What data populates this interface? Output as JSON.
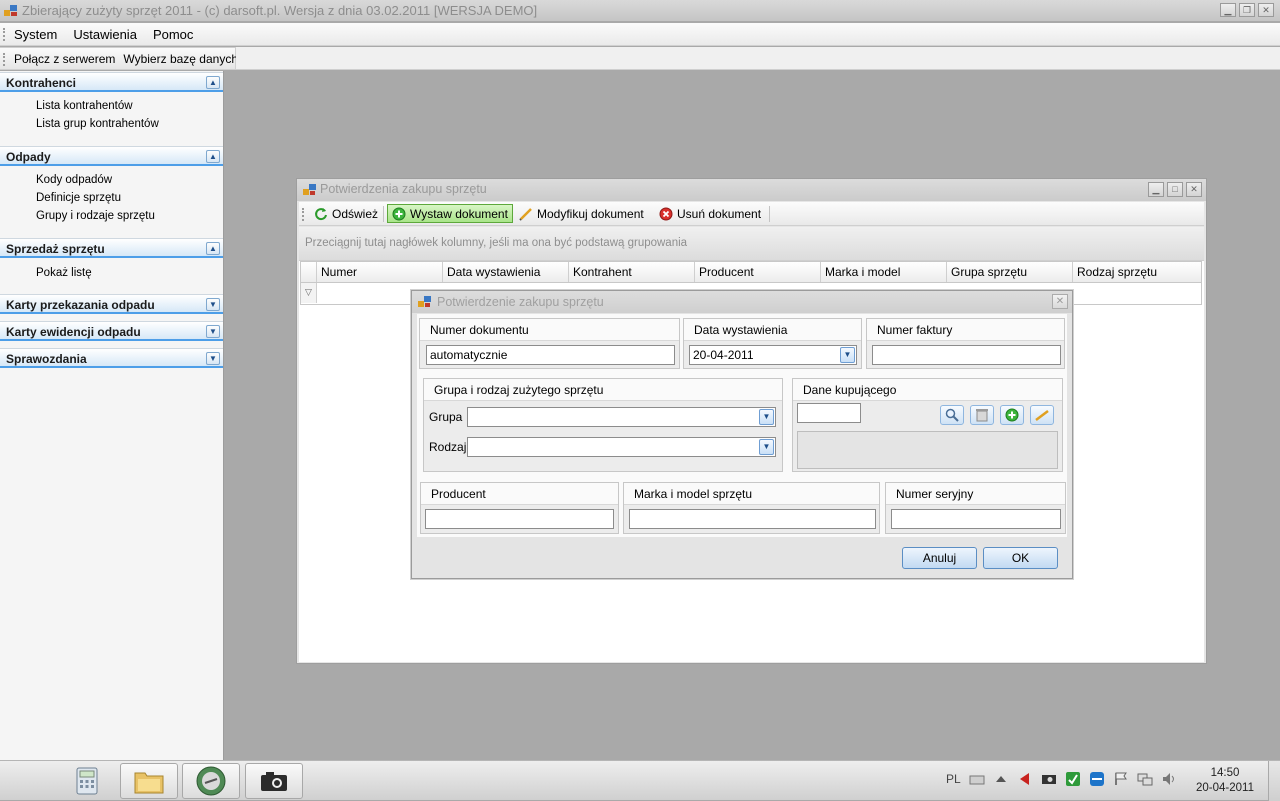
{
  "window": {
    "title": "Zbierający zużyty sprzęt 2011 - (c) darsoft.pl. Wersja z dnia 03.02.2011 [WERSJA DEMO]"
  },
  "menu": [
    "System",
    "Ustawienia",
    "Pomoc"
  ],
  "toolbar": [
    "Połącz z serwerem",
    "Wybierz bazę danych"
  ],
  "sidebar": {
    "sections": [
      {
        "title": "Kontrahenci",
        "expanded": true,
        "items": [
          "Lista kontrahentów",
          "Lista grup kontrahentów"
        ]
      },
      {
        "title": "Odpady",
        "expanded": true,
        "items": [
          "Kody odpadów",
          "Definicje sprzętu",
          "Grupy i rodzaje sprzętu"
        ]
      },
      {
        "title": "Sprzedaż sprzętu",
        "expanded": true,
        "items": [
          "Pokaż listę"
        ]
      },
      {
        "title": "Karty przekazania odpadu",
        "expanded": false,
        "items": []
      },
      {
        "title": "Karty ewidencji odpadu",
        "expanded": false,
        "items": []
      },
      {
        "title": "Sprawozdania",
        "expanded": false,
        "items": []
      }
    ]
  },
  "child_window": {
    "title": "Potwierdzenia zakupu sprzętu",
    "toolbar": {
      "refresh": "Odśwież",
      "issue": "Wystaw dokument",
      "modify": "Modyfikuj dokument",
      "delete": "Usuń dokument"
    },
    "group_hint": "Przeciągnij tutaj nagłówek kolumny, jeśli ma ona być podstawą grupowania",
    "columns": [
      "Numer",
      "Data wystawienia",
      "Kontrahent",
      "Producent",
      "Marka i model",
      "Grupa sprzętu",
      "Rodzaj sprzętu"
    ]
  },
  "dialog": {
    "title": "Potwierdzenie zakupu sprzętu",
    "numer_dokumentu": {
      "label": "Numer dokumentu",
      "value": "automatycznie"
    },
    "data_wystawienia": {
      "label": "Data wystawienia",
      "value": "20-04-2011"
    },
    "numer_faktury": {
      "label": "Numer faktury",
      "value": ""
    },
    "grupa_rodzaj": {
      "label": "Grupa i rodzaj zużytego sprzętu",
      "grupa_label": "Grupa",
      "rodzaj_label": "Rodzaj",
      "grupa_value": "",
      "rodzaj_value": ""
    },
    "dane_kupujacego": {
      "label": "Dane kupującego",
      "value": ""
    },
    "producent": {
      "label": "Producent",
      "value": ""
    },
    "marka": {
      "label": "Marka i model sprzętu",
      "value": ""
    },
    "numer_seryjny": {
      "label": "Numer seryjny",
      "value": ""
    },
    "cancel": "Anuluj",
    "ok": "OK"
  },
  "taskbar": {
    "lang": "PL",
    "time": "14:50",
    "date": "20-04-2011"
  },
  "colors": {
    "accent": "#4d9ee8",
    "active_button": "#a9e58a",
    "desktop": "#a9a9a9"
  }
}
